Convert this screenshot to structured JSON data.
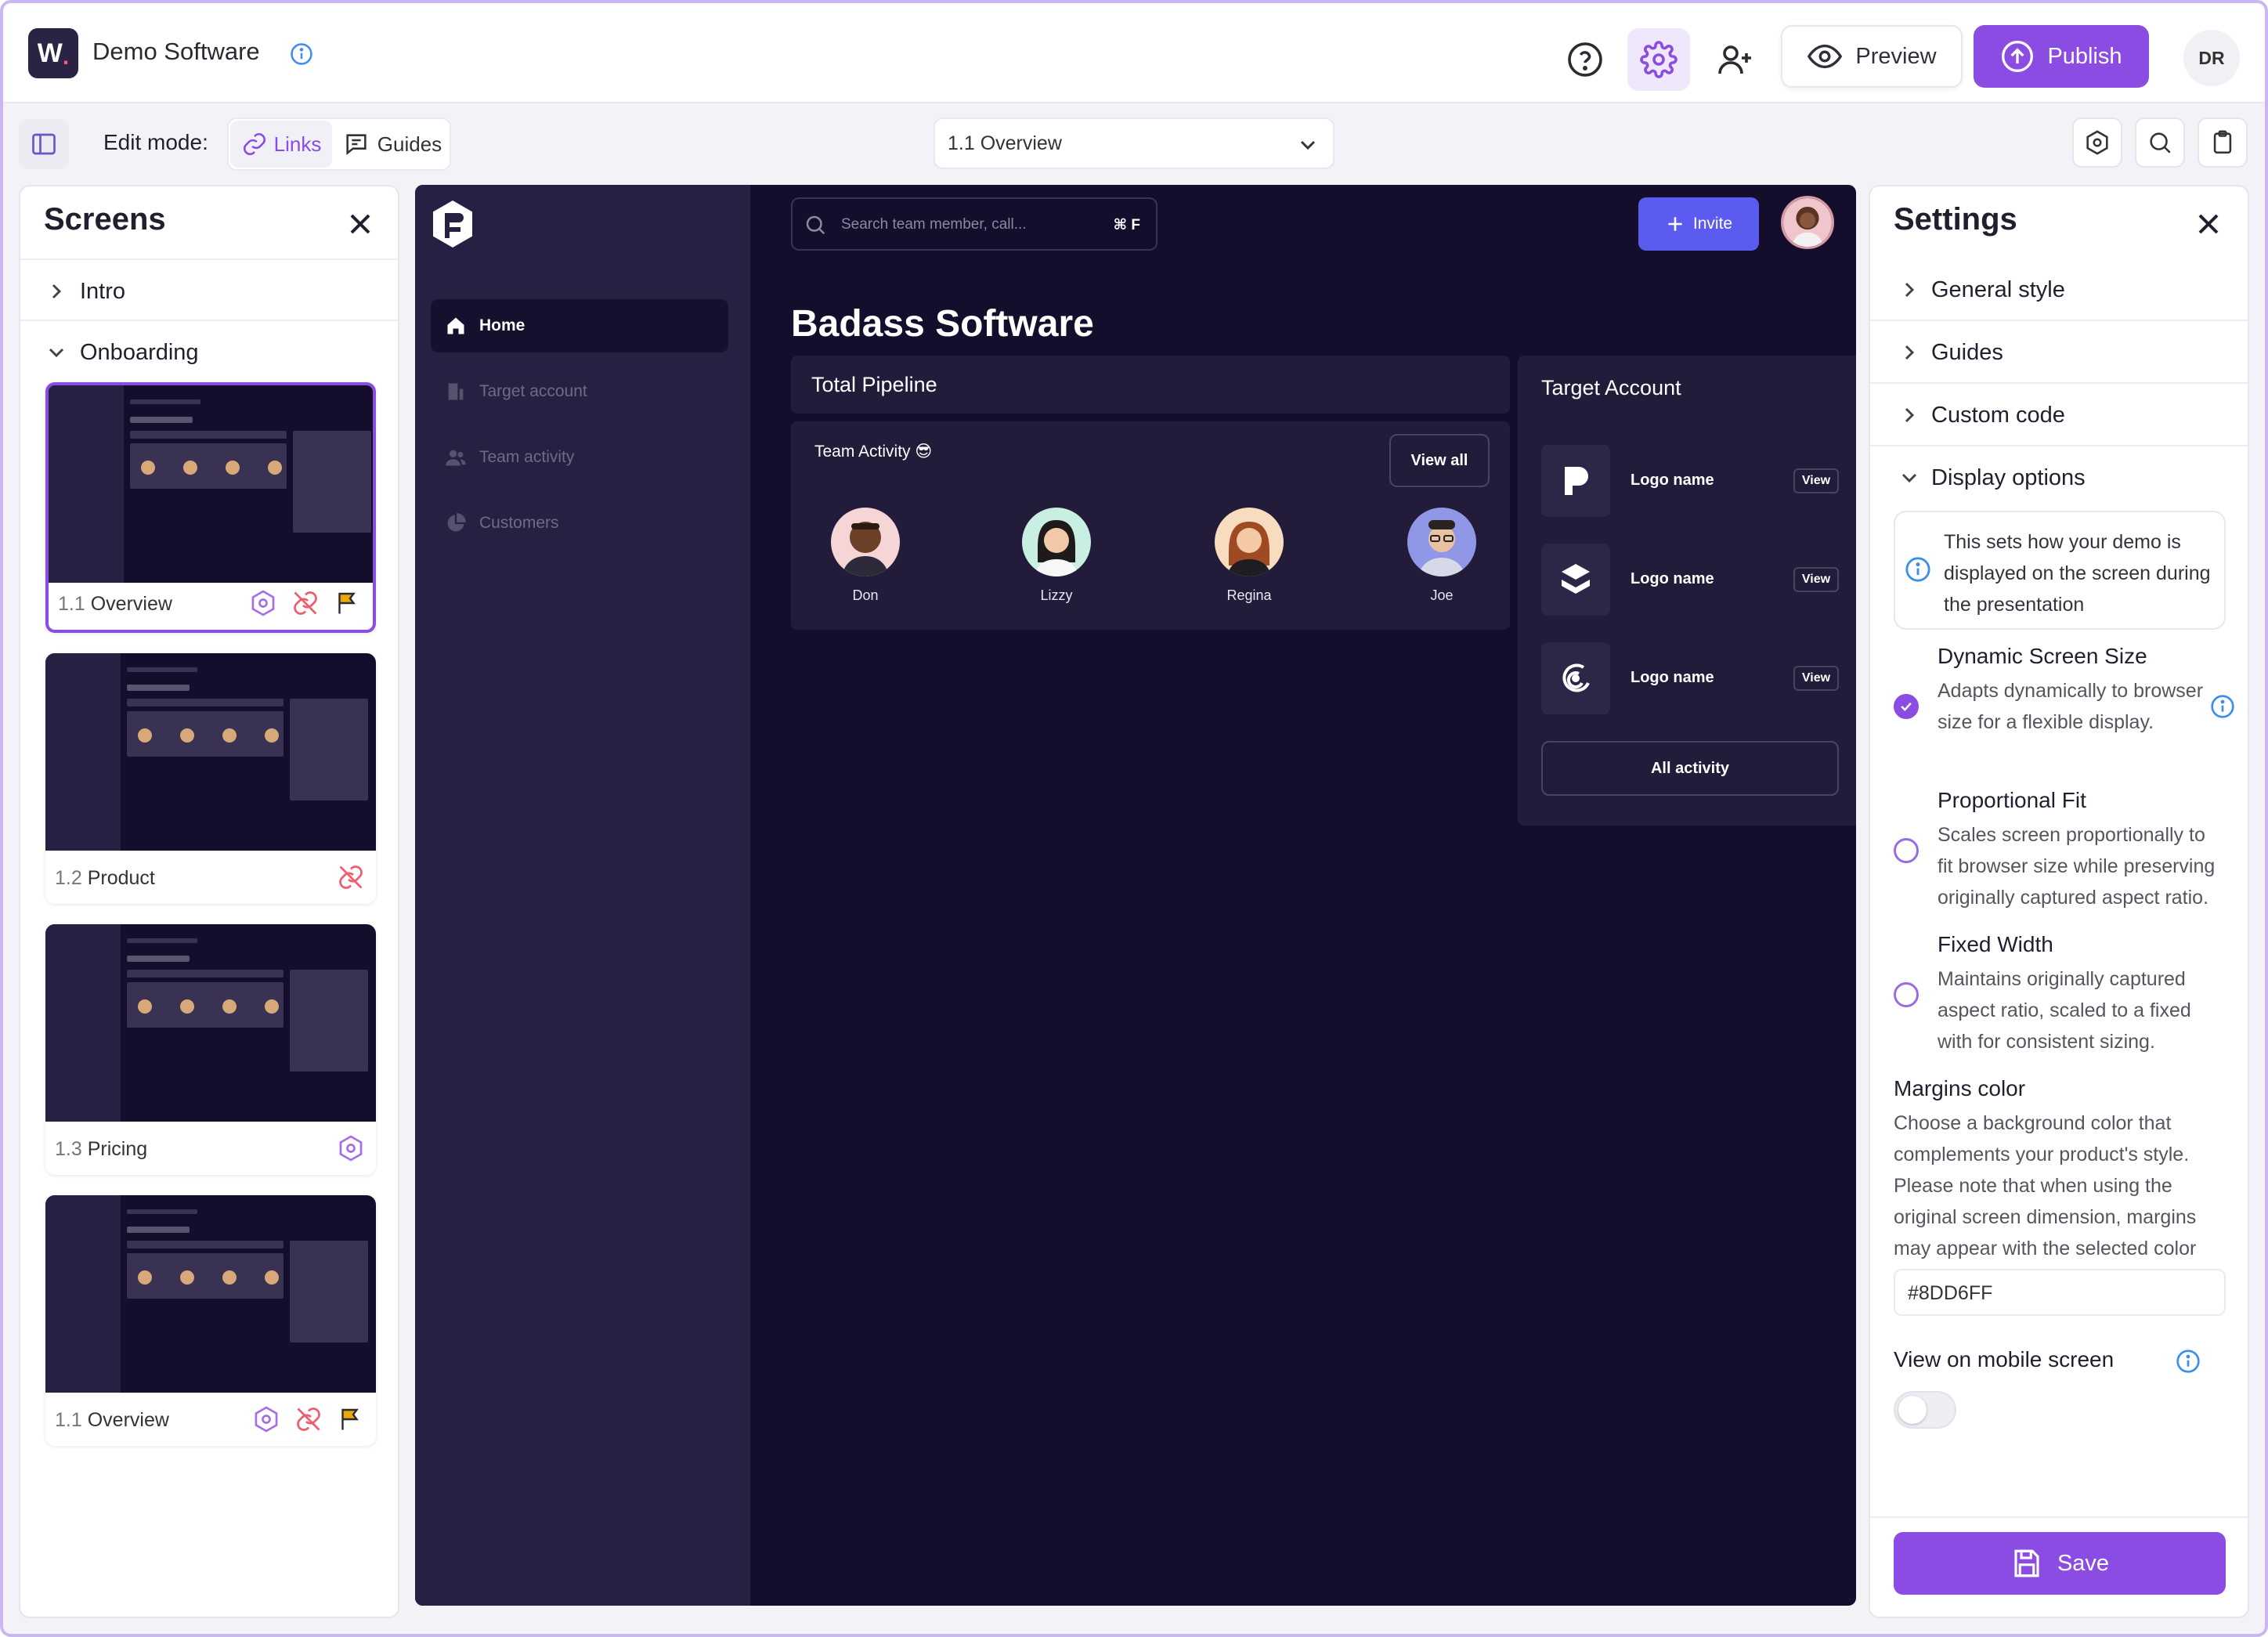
{
  "header": {
    "logo_letter": "W",
    "logo_dot": ".",
    "title": "Demo Software",
    "preview_label": "Preview",
    "publish_label": "Publish",
    "user_initials": "DR"
  },
  "toolbar": {
    "edit_mode_label": "Edit mode:",
    "links_label": "Links",
    "guides_label": "Guides",
    "screen_select_value": "1.1 Overview"
  },
  "screens_panel": {
    "title": "Screens",
    "sections": [
      {
        "label": "Intro",
        "expanded": false
      },
      {
        "label": "Onboarding",
        "expanded": true
      }
    ],
    "screens": [
      {
        "num": "1.1",
        "name": "Overview",
        "selected": true,
        "icons": [
          "hex-icon",
          "unlink-icon",
          "flag-icon"
        ]
      },
      {
        "num": "1.2",
        "name": "Product",
        "selected": false,
        "icons": [
          "unlink-icon"
        ]
      },
      {
        "num": "1.3",
        "name": "Pricing",
        "selected": false,
        "icons": [
          "hex-icon"
        ]
      },
      {
        "num": "1.1",
        "name": "Overview",
        "selected": false,
        "icons": [
          "hex-icon",
          "unlink-icon",
          "flag-icon"
        ]
      }
    ]
  },
  "app": {
    "nav": [
      "Home",
      "Target account",
      "Team activity",
      "Customers"
    ],
    "search_placeholder": "Search team member, call...",
    "search_shortcut": "⌘ F",
    "invite_label": "Invite",
    "heading": "Badass Software",
    "pipeline_title": "Total Pipeline",
    "team_activity_title": "Team Activity 😎",
    "view_all_label": "View all",
    "members": [
      "Don",
      "Lizzy",
      "Regina",
      "Joe"
    ],
    "target_account_title": "Target Account",
    "accounts": [
      {
        "name": "Logo name",
        "view": "View",
        "icon": "p-logo-icon"
      },
      {
        "name": "Logo name",
        "view": "View",
        "icon": "layers-logo-icon"
      },
      {
        "name": "Logo name",
        "view": "View",
        "icon": "swirl-logo-icon"
      }
    ],
    "all_activity_label": "All activity"
  },
  "settings": {
    "title": "Settings",
    "sections": [
      "General style",
      "Guides",
      "Custom code",
      "Display options"
    ],
    "display_info": "This sets how your demo is displayed on the screen during the presentation",
    "options": [
      {
        "title": "Dynamic Screen Size",
        "desc": "Adapts dynamically to browser size for a flexible display.",
        "checked": true
      },
      {
        "title": "Proportional Fit",
        "desc": "Scales screen proportionally to fit browser size while preserving originally captured aspect ratio.",
        "checked": false
      },
      {
        "title": "Fixed Width",
        "desc": "Maintains originally captured aspect ratio, scaled to a fixed with for consistent sizing.",
        "checked": false
      }
    ],
    "margins_title": "Margins color",
    "margins_desc": "Choose a background color that complements your product's style. Please note that when using the original screen dimension, margins may appear with the selected color",
    "margins_value": "#8DD6FF",
    "mobile_label": "View on mobile screen",
    "mobile_enabled": false,
    "save_label": "Save"
  },
  "colors": {
    "accent": "#8b4ce4",
    "app_bg": "#140d2b",
    "app_sidebar": "#272042",
    "invite": "#5b5bf0",
    "warning": "#e8a900",
    "danger": "#ef5d6e"
  }
}
